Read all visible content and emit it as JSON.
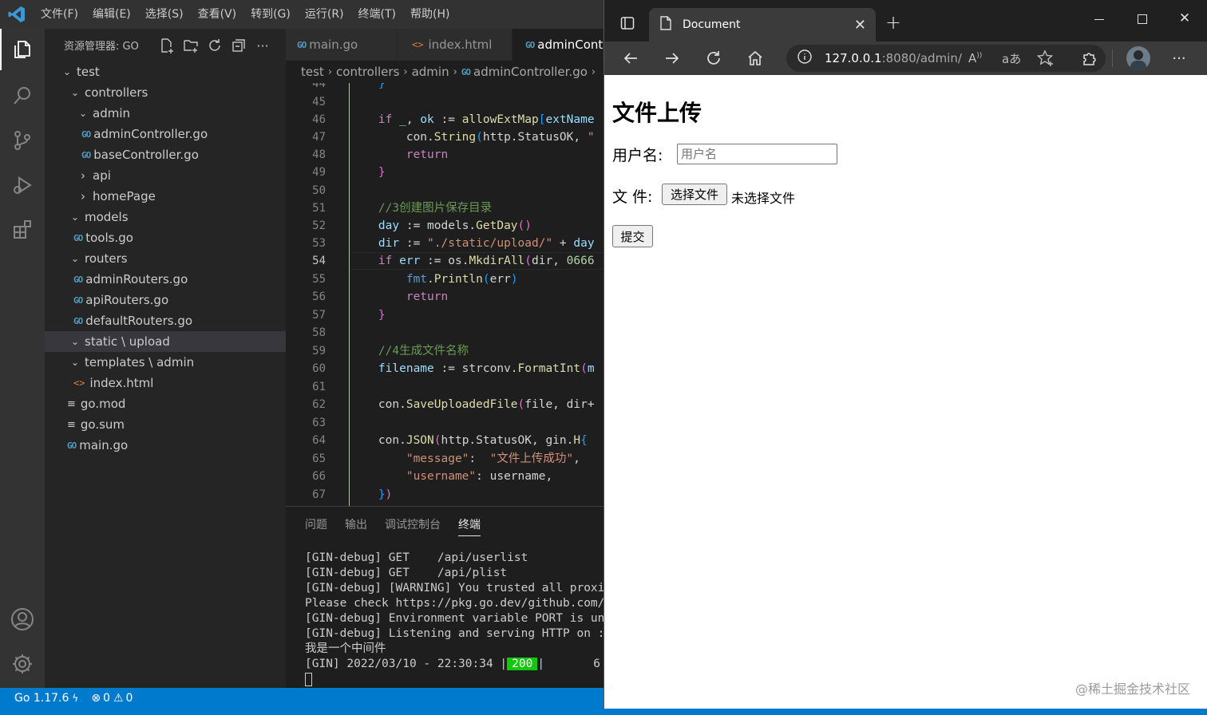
{
  "menu": [
    "文件(F)",
    "编辑(E)",
    "选择(S)",
    "查看(V)",
    "转到(G)",
    "运行(R)",
    "终端(T)",
    "帮助(H)"
  ],
  "explorer": {
    "title": "资源管理器: GO",
    "tree": [
      {
        "label": "test",
        "kind": "folder-open"
      },
      {
        "label": "controllers",
        "kind": "folder-open"
      },
      {
        "label": "admin",
        "kind": "folder-open"
      },
      {
        "label": "adminController.go",
        "kind": "go"
      },
      {
        "label": "baseController.go",
        "kind": "go"
      },
      {
        "label": "api",
        "kind": "folder"
      },
      {
        "label": "homePage",
        "kind": "folder"
      },
      {
        "label": "models",
        "kind": "folder-open"
      },
      {
        "label": "tools.go",
        "kind": "go"
      },
      {
        "label": "routers",
        "kind": "folder-open"
      },
      {
        "label": "adminRouters.go",
        "kind": "go"
      },
      {
        "label": "apiRouters.go",
        "kind": "go"
      },
      {
        "label": "defaultRouters.go",
        "kind": "go"
      },
      {
        "label": "static \\ upload",
        "kind": "folder-open"
      },
      {
        "label": "templates \\ admin",
        "kind": "folder-open"
      },
      {
        "label": "index.html",
        "kind": "html"
      },
      {
        "label": "go.mod",
        "kind": "mod"
      },
      {
        "label": "go.sum",
        "kind": "mod"
      },
      {
        "label": "main.go",
        "kind": "go"
      }
    ]
  },
  "tabs": [
    {
      "label": "main.go",
      "icon": "go"
    },
    {
      "label": "index.html",
      "icon": "html"
    },
    {
      "label": "adminCont",
      "icon": "go"
    }
  ],
  "breadcrumb": [
    "test",
    "controllers",
    "admin",
    "adminController.go"
  ],
  "editor": {
    "line_numbers": [
      "44",
      "45",
      "46",
      "47",
      "48",
      "49",
      "50",
      "51",
      "52",
      "53",
      "54",
      "55",
      "56",
      "57",
      "58",
      "59",
      "60",
      "61",
      "62",
      "63",
      "64",
      "65",
      "66",
      "67"
    ],
    "current_line": "54"
  },
  "panel": {
    "tabs": [
      "问题",
      "输出",
      "调试控制台",
      "终端"
    ],
    "terminal": [
      "[GIN-debug] GET    /api/userlist",
      "[GIN-debug] GET    /api/plist",
      "[GIN-debug] [WARNING] You trusted all proxi",
      "Please check https://pkg.go.dev/github.com/",
      "[GIN-debug] Environment variable PORT is un",
      "[GIN-debug] Listening and serving HTTP on :",
      "我是一个中间件"
    ],
    "gin_line_prefix": "[GIN] 2022/03/10 - 22:30:34 |",
    "gin_status": "200",
    "gin_line_suffix": "|       6",
    "colors": {
      "status_ok": "#16c60c"
    }
  },
  "status": {
    "go_version": "Go 1.17.6",
    "errors": "0",
    "warnings": "0"
  },
  "browser": {
    "tab_title": "Document",
    "url_host": "127.0.0.1",
    "url_rest": ":8080/admin/"
  },
  "page": {
    "heading": "文件上传",
    "username_label": "用户名:",
    "username_placeholder": "用户名",
    "file_label": "文 件:",
    "file_button": "选择文件",
    "file_status": "未选择文件",
    "submit": "提交"
  },
  "watermark": "@稀土掘金技术社区",
  "colors": {
    "accent": "#007acc",
    "titlebar": "#323233",
    "sidebar": "#252526",
    "editor": "#1e1e1e"
  }
}
